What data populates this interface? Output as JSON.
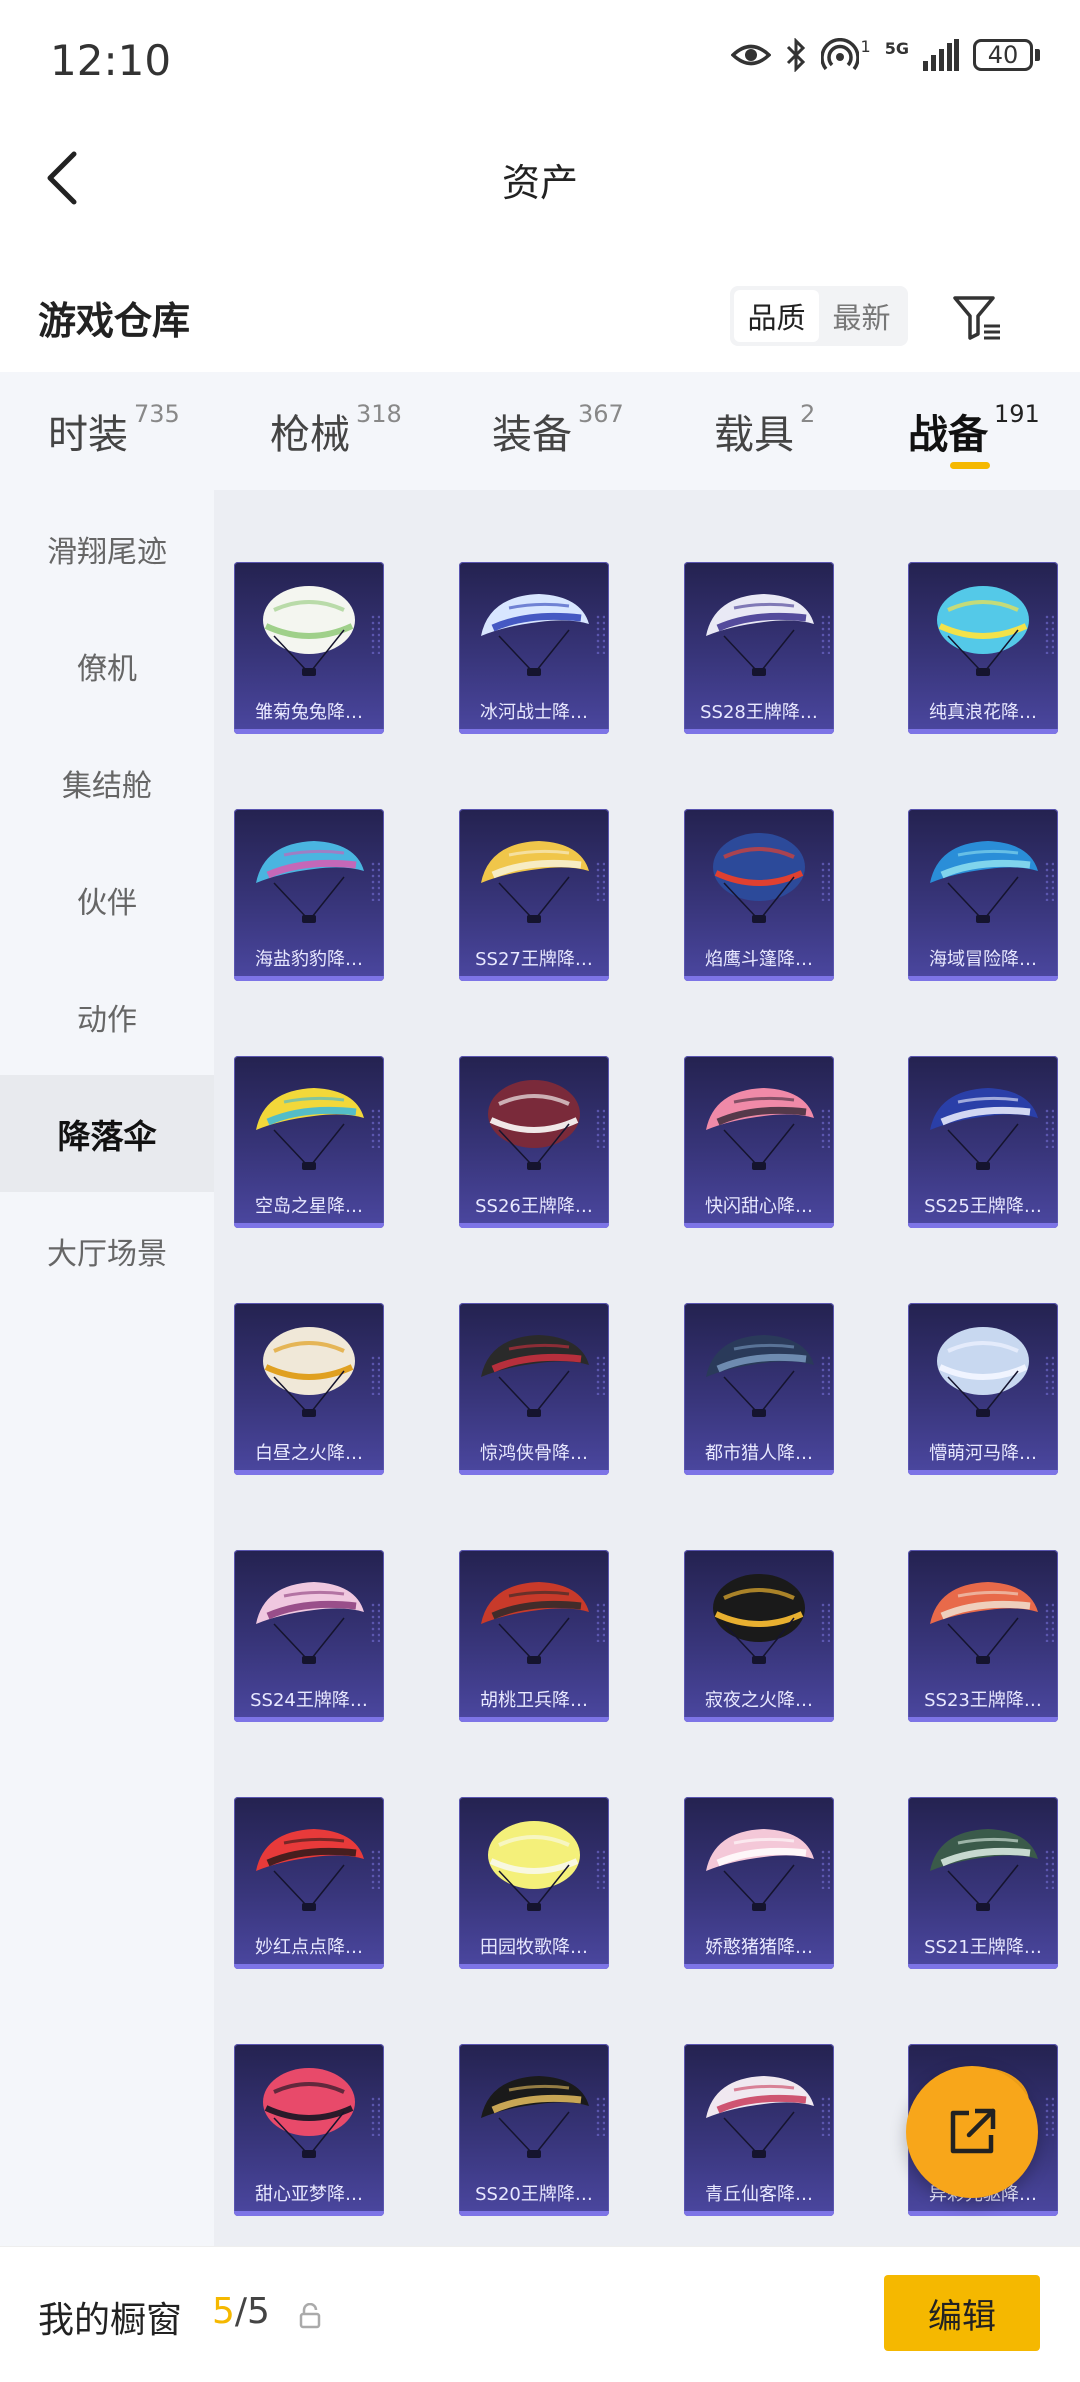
{
  "status_bar": {
    "time": "12:10",
    "network": "5G",
    "battery": "40",
    "sim_indicator": "1"
  },
  "nav": {
    "title": "资产"
  },
  "warehouse": {
    "title": "游戏仓库",
    "sort_options": [
      {
        "label": "品质",
        "active": true
      },
      {
        "label": "最新",
        "active": false
      }
    ]
  },
  "tabs": [
    {
      "label": "时装",
      "count": "735",
      "active": false
    },
    {
      "label": "枪械",
      "count": "318",
      "active": false
    },
    {
      "label": "装备",
      "count": "367",
      "active": false
    },
    {
      "label": "载具",
      "count": "2",
      "active": false
    },
    {
      "label": "战备",
      "count": "191",
      "active": true
    }
  ],
  "side_nav": [
    {
      "label": "滑翔尾迹",
      "active": false
    },
    {
      "label": "僚机",
      "active": false
    },
    {
      "label": "集结舱",
      "active": false
    },
    {
      "label": "伙伴",
      "active": false
    },
    {
      "label": "动作",
      "active": false
    },
    {
      "label": "降落伞",
      "active": true
    },
    {
      "label": "大厅场景",
      "active": false
    }
  ],
  "items": [
    {
      "name": "雏菊兔兔降…",
      "colors": [
        "#f4f6f0",
        "#9fd08a"
      ]
    },
    {
      "name": "冰河战士降…",
      "colors": [
        "#d8e6ff",
        "#2b3fb8"
      ]
    },
    {
      "name": "SS28王牌降…",
      "colors": [
        "#e9e9f5",
        "#3a2f8c"
      ]
    },
    {
      "name": "纯真浪花降…",
      "colors": [
        "#54c9e8",
        "#f3e24a"
      ]
    },
    {
      "name": "海盐豹豹降…",
      "colors": [
        "#4ab5e0",
        "#d95ab0"
      ]
    },
    {
      "name": "SS27王牌降…",
      "colors": [
        "#f0c64a",
        "#f8f2d8"
      ]
    },
    {
      "name": "焰鹰斗篷降…",
      "colors": [
        "#2c4a9a",
        "#e04030"
      ]
    },
    {
      "name": "海域冒险降…",
      "colors": [
        "#2a8ed8",
        "#8fe0f0"
      ]
    },
    {
      "name": "空岛之星降…",
      "colors": [
        "#f2d83a",
        "#38b8e0"
      ]
    },
    {
      "name": "SS26王牌降…",
      "colors": [
        "#7a2a3a",
        "#f0e8e8"
      ]
    },
    {
      "name": "快闪甜心降…",
      "colors": [
        "#f08aa8",
        "#3a2a3a"
      ]
    },
    {
      "name": "SS25王牌降…",
      "colors": [
        "#2a3fa8",
        "#f0f2ff"
      ]
    },
    {
      "name": "白昼之火降…",
      "colors": [
        "#f0e8d8",
        "#e0a020"
      ]
    },
    {
      "name": "惊鸿侠骨降…",
      "colors": [
        "#2a2a2a",
        "#d03040"
      ]
    },
    {
      "name": "都市猎人降…",
      "colors": [
        "#2a3a5a",
        "#7a9ac0"
      ]
    },
    {
      "name": "懵萌河马降…",
      "colors": [
        "#c8d8f0",
        "#f0f4ff"
      ]
    },
    {
      "name": "SS24王牌降…",
      "colors": [
        "#f0c8e0",
        "#8a3a7a"
      ]
    },
    {
      "name": "胡桃卫兵降…",
      "colors": [
        "#c83a2a",
        "#2a2a2a"
      ]
    },
    {
      "name": "寂夜之火降…",
      "colors": [
        "#1a1a1a",
        "#e8b030"
      ]
    },
    {
      "name": "SS23王牌降…",
      "colors": [
        "#e86a4a",
        "#f0e0d0"
      ]
    },
    {
      "name": "妙红点点降…",
      "colors": [
        "#e83a3a",
        "#2a1a1a"
      ]
    },
    {
      "name": "田园牧歌降…",
      "colors": [
        "#f4f07a",
        "#f8f8e0"
      ]
    },
    {
      "name": "娇憨猪猪降…",
      "colors": [
        "#f4c8d8",
        "#ffffff"
      ]
    },
    {
      "name": "SS21王牌降…",
      "colors": [
        "#3a5a4a",
        "#e0f0e8"
      ]
    },
    {
      "name": "甜心亚梦降…",
      "colors": [
        "#e84a6a",
        "#2a1a2a"
      ]
    },
    {
      "name": "SS20王牌降…",
      "colors": [
        "#1a1a1a",
        "#e8c060"
      ]
    },
    {
      "name": "青丘仙客降…",
      "colors": [
        "#f0e8f0",
        "#c83a5a"
      ]
    },
    {
      "name": "异彩先驱降…",
      "colors": [
        "#f8a61a",
        "#f8a61a"
      ]
    }
  ],
  "bottom": {
    "showcase_label": "我的橱窗",
    "showcase_current": "5",
    "showcase_total": "/5",
    "edit_label": "编辑"
  },
  "accent_color": "#f5b800",
  "fab_color": "#f8a61a"
}
